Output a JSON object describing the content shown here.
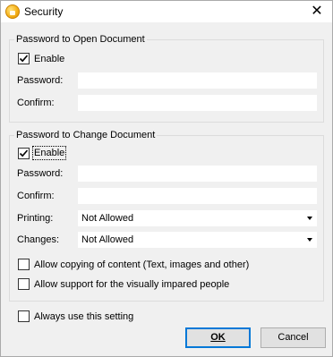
{
  "window": {
    "title": "Security",
    "icon": "app-icon",
    "close_glyph": "✕"
  },
  "open_group": {
    "legend": "Password to Open Document",
    "enable_label": "Enable",
    "enable_checked": true,
    "password_label": "Password:",
    "password_value": "",
    "confirm_label": "Confirm:",
    "confirm_value": ""
  },
  "change_group": {
    "legend": "Password to Change Document",
    "enable_label": "Enable",
    "enable_checked": true,
    "password_label": "Password:",
    "password_value": "",
    "confirm_label": "Confirm:",
    "confirm_value": "",
    "printing_label": "Printing:",
    "printing_value": "Not Allowed",
    "changes_label": "Changes:",
    "changes_value": "Not Allowed",
    "allow_copy_label": "Allow copying of content (Text, images and other)",
    "allow_copy_checked": false,
    "allow_visually_impaired_label": "Allow support for the visually impared people",
    "allow_visually_impaired_checked": false
  },
  "always_use_label": "Always use this setting",
  "always_use_checked": false,
  "buttons": {
    "ok": "OK",
    "cancel": "Cancel"
  }
}
